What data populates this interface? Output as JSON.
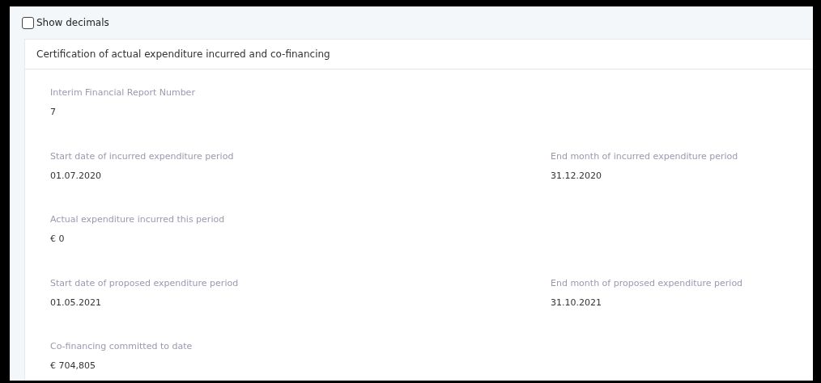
{
  "show_decimals": {
    "label": "Show decimals",
    "checked": false
  },
  "section": {
    "title": "Certification of actual expenditure incurred and co-financing",
    "rows": [
      [
        {
          "label": "Interim Financial Report Number",
          "value": "7"
        }
      ],
      [
        {
          "label": "Start date of incurred expenditure period",
          "value": "01.07.2020"
        },
        {
          "label": "End month of incurred expenditure period",
          "value": "31.12.2020"
        }
      ],
      [
        {
          "label": "Actual expenditure incurred this period",
          "value": "€ 0"
        }
      ],
      [
        {
          "label": "Start date of proposed expenditure period",
          "value": "01.05.2021"
        },
        {
          "label": "End month of proposed expenditure period",
          "value": "31.10.2021"
        }
      ],
      [
        {
          "label": "Co-financing committed to date",
          "value": "€ 704,805"
        }
      ]
    ]
  }
}
